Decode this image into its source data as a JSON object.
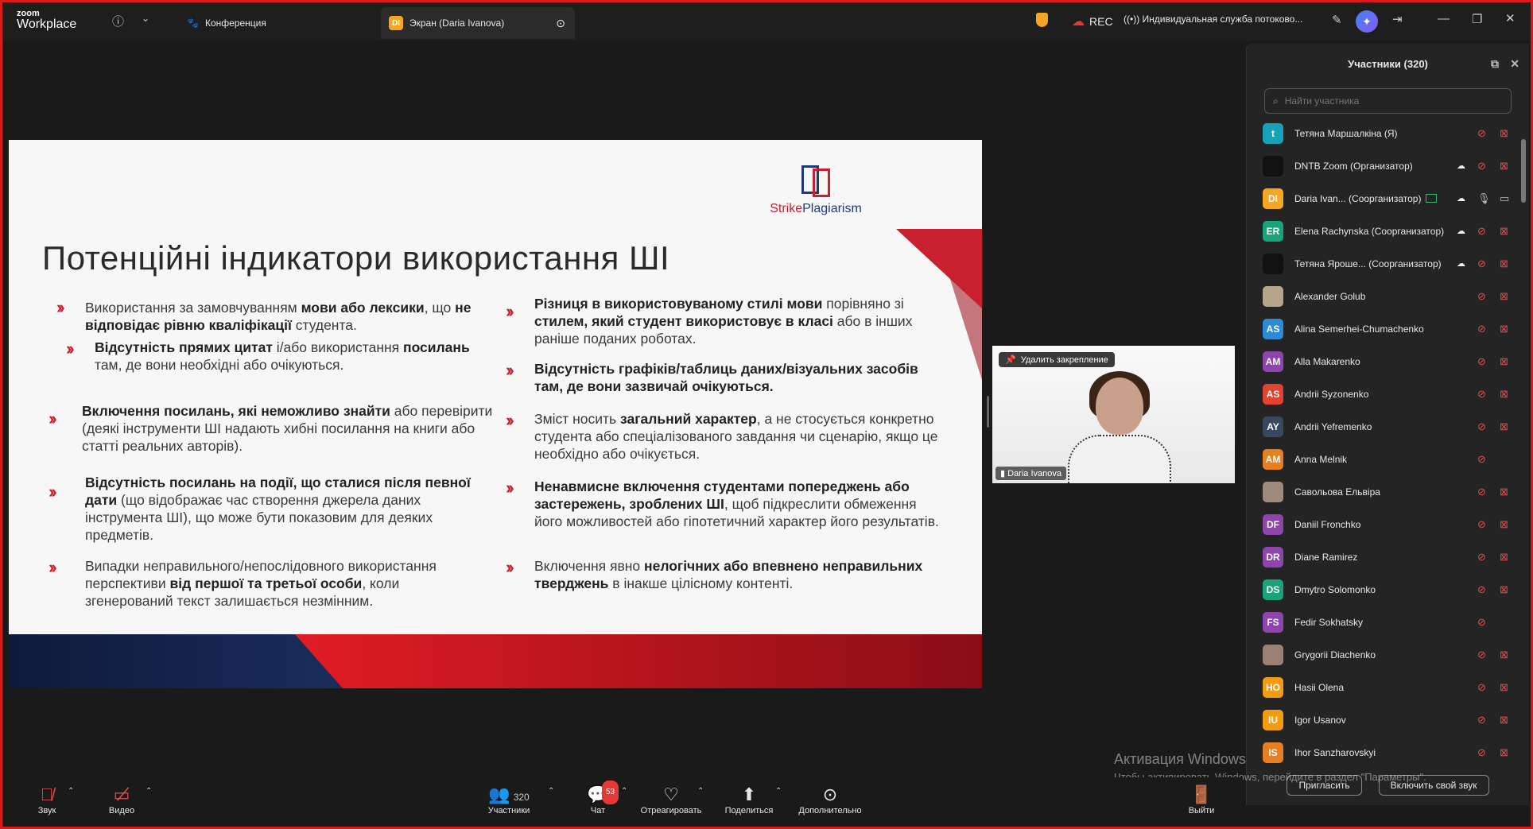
{
  "app": {
    "logo_top": "zoom",
    "logo_bottom": "Workplace"
  },
  "tabs": [
    {
      "label": "Конференция"
    },
    {
      "label": "Экран (Daria Ivanova)",
      "badge": "DI"
    }
  ],
  "topbar": {
    "rec_label": "REC",
    "live_label": "Индивидуальная служба потоково..."
  },
  "slide": {
    "logo_strike": "Strike",
    "logo_plag": "Plagiarism",
    "title": "Потенційні індикатори використання ШІ",
    "left": [
      [
        "Використання за замовчуванням ",
        "мови або лексики",
        ", що ",
        "не відповідає рівню кваліфікації",
        " студента."
      ],
      [
        "",
        "Відсутність прямих цитат",
        " і/або використання ",
        "посилань",
        " там, де вони необхідні або очікуються."
      ],
      [
        "",
        "Включення посилань, які неможливо знайти",
        " або перевірити (деякі інструменти ШІ надають хибні посилання на книги або статті реальних авторів)."
      ],
      [
        "",
        "Відсутність посилань на події, що сталися після певної дати",
        " (що відображає час створення джерела даних інструмента ШІ), що може бути показовим для деяких предметів."
      ],
      [
        "Випадки неправильного/непослідовного використання перспективи ",
        "від першої та третьої особи",
        ", коли згенерований текст залишається незмінним."
      ]
    ],
    "right": [
      [
        "",
        "Різниця в використовуваному стилі мови",
        " порівняно зі ",
        "стилем, який студент використовує в класі",
        " або в інших раніше поданих роботах."
      ],
      [
        "",
        "Відсутність графіків/таблиць даних/візуальних засобів там, де вони зазвичай очікуються.",
        "",
        "",
        ""
      ],
      [
        "Зміст носить ",
        "загальний характер",
        ", а не стосується конкретно студента або спеціалізованого завдання чи сценарію, якщо це необхідно або очікується.",
        "",
        ""
      ],
      [
        "",
        "Ненавмисне включення студентами попереджень або застережень, зроблених ШІ",
        ", щоб підкреслити обмеження його можливостей або гіпотетичний характер його результатів.",
        "",
        ""
      ],
      [
        "Включення явно ",
        "нелогічних або впевнено неправильних тверджень",
        " в інакше цілісному контенті.",
        "",
        ""
      ]
    ]
  },
  "video": {
    "unpin_label": "Удалить закрепление",
    "name": "Daria Ivanova"
  },
  "participants": {
    "title": "Участники (320)",
    "search_placeholder": "Найти участника",
    "list": [
      {
        "initials": "t",
        "color": "#17a2b8",
        "name": "Тетяна Маршалкіна (Я)"
      },
      {
        "initials": "",
        "color": "#111111",
        "name": "DNTB Zoom (Организатор)",
        "cloud": true
      },
      {
        "initials": "DI",
        "color": "#f5a623",
        "name": "Daria Ivan...  (Соорганизатор)",
        "cloud": true,
        "sharing": true,
        "active": true
      },
      {
        "initials": "ER",
        "color": "#1aa37a",
        "name": "Elena Rachynska (Соорганизатор)",
        "cloud": true
      },
      {
        "initials": "",
        "color": "#111111",
        "name": "Тетяна Яроше...  (Соорганизатор)",
        "cloud": true
      },
      {
        "initials": "",
        "color": "#b8a48a",
        "name": "Alexander Golub"
      },
      {
        "initials": "AS",
        "color": "#2b8bd6",
        "name": "Alina Semerhei-Chumachenko"
      },
      {
        "initials": "AM",
        "color": "#8e44ad",
        "name": "Alla Makarenko"
      },
      {
        "initials": "AS",
        "color": "#e0432f",
        "name": "Andrii Syzonenko"
      },
      {
        "initials": "AY",
        "color": "#34495e",
        "name": "Andrii Yefremenko"
      },
      {
        "initials": "AM",
        "color": "#e67e22",
        "name": "Anna Melnik",
        "no_cam": true
      },
      {
        "initials": "",
        "color": "#a08a7a",
        "name": "Савольова Ельвіра"
      },
      {
        "initials": "DF",
        "color": "#8e44ad",
        "name": "Daniil Fronchko"
      },
      {
        "initials": "DR",
        "color": "#8e44ad",
        "name": "Diane Ramirez"
      },
      {
        "initials": "DS",
        "color": "#1aa37a",
        "name": "Dmytro Solomonko"
      },
      {
        "initials": "FS",
        "color": "#8e44ad",
        "name": "Fedir Sokhatsky",
        "no_cam": true
      },
      {
        "initials": "",
        "color": "#9a8070",
        "name": "Grygorii Diachenko"
      },
      {
        "initials": "HO",
        "color": "#f39c12",
        "name": "Hasii Olena"
      },
      {
        "initials": "IU",
        "color": "#f39c12",
        "name": "Igor Usanov"
      },
      {
        "initials": "IS",
        "color": "#e67e22",
        "name": "Ihor Sanzharovskyi"
      }
    ],
    "invite_label": "Пригласить",
    "unmute_label": "Включить свой звук"
  },
  "windows": {
    "line1": "Активация Windows",
    "line2": "Чтобы активировать Windows, перейдите в раздел \"Параметры\"."
  },
  "toolbar": {
    "audio": "Звук",
    "video": "Видео",
    "participants": "Участники",
    "participants_count": "320",
    "chat": "Чат",
    "chat_badge": "53",
    "react": "Отреагировать",
    "share": "Поделиться",
    "more": "Дополнительно",
    "leave": "Выйти"
  }
}
